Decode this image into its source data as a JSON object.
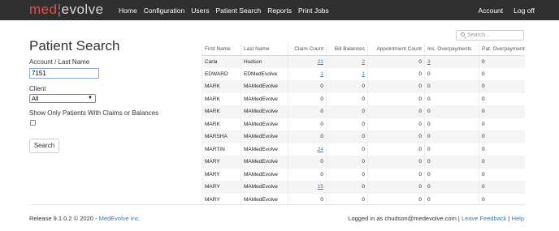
{
  "brand": {
    "part1": "med",
    "part2": "evolve"
  },
  "nav": {
    "left": [
      "Home",
      "Configuration",
      "Users",
      "Patient Search",
      "Reports",
      "Print Jobs"
    ],
    "right": [
      "Account",
      "Log off"
    ]
  },
  "form": {
    "title": "Patient Search",
    "account_label": "Account / Last Name",
    "account_value": "7151",
    "client_label": "Client",
    "client_value": "All",
    "checkbox_label": "Show Only Patients With Claims or Balances",
    "search_button": "Search"
  },
  "table": {
    "search_placeholder": "Search...",
    "columns": [
      "First Name",
      "Last Name",
      "Claim Count",
      "Bill Balances",
      "Appointment Count",
      "Ins. Overpayments",
      "Pat. Overpayments"
    ],
    "rows": [
      [
        "Carla",
        "Hudson",
        "21",
        "2",
        "0",
        "3",
        "0"
      ],
      [
        "EDWARD",
        "EDMedEvolve",
        "1",
        "1",
        "0",
        "0",
        "0"
      ],
      [
        "MARK",
        "MAMedEvolve",
        "0",
        "0",
        "0",
        "0",
        "0"
      ],
      [
        "MARK",
        "MAMedEvolve",
        "0",
        "0",
        "0",
        "0",
        "0"
      ],
      [
        "MARK",
        "MAMedEvolve",
        "0",
        "0",
        "0",
        "0",
        "0"
      ],
      [
        "MARK",
        "MAMedEvolve",
        "0",
        "0",
        "0",
        "0",
        "0"
      ],
      [
        "MARSHA",
        "MAMedEvolve",
        "0",
        "0",
        "0",
        "0",
        "0"
      ],
      [
        "MARTIN",
        "MAMedEvolve",
        "24",
        "0",
        "0",
        "0",
        "0"
      ],
      [
        "MARY",
        "MAMedEvolve",
        "0",
        "0",
        "0",
        "0",
        "0"
      ],
      [
        "MARY",
        "MAMedEvolve",
        "0",
        "0",
        "0",
        "0",
        "0"
      ],
      [
        "MARY",
        "MAMedEvolve",
        "15",
        "0",
        "0",
        "0",
        "0"
      ],
      [
        "MARY",
        "MAMedEvolve",
        "0",
        "0",
        "0",
        "0",
        "0"
      ]
    ],
    "links": [
      [
        "0",
        "2",
        "21"
      ],
      [
        "0",
        "3",
        "2"
      ],
      [
        "0",
        "5",
        "3"
      ],
      [
        "1",
        "2",
        "1"
      ],
      [
        "1",
        "3",
        "1"
      ],
      [
        "7",
        "2",
        "24"
      ],
      [
        "10",
        "2",
        "15"
      ]
    ]
  },
  "footer": {
    "release": "Release 9.1.0.2 © 2020 -",
    "company_link": "MedEvolve Inc.",
    "logged_in": "Logged in as chudson@medevolve.com |",
    "feedback_link": "Leave Feedback",
    "sep": "|",
    "help_link": "Help"
  }
}
